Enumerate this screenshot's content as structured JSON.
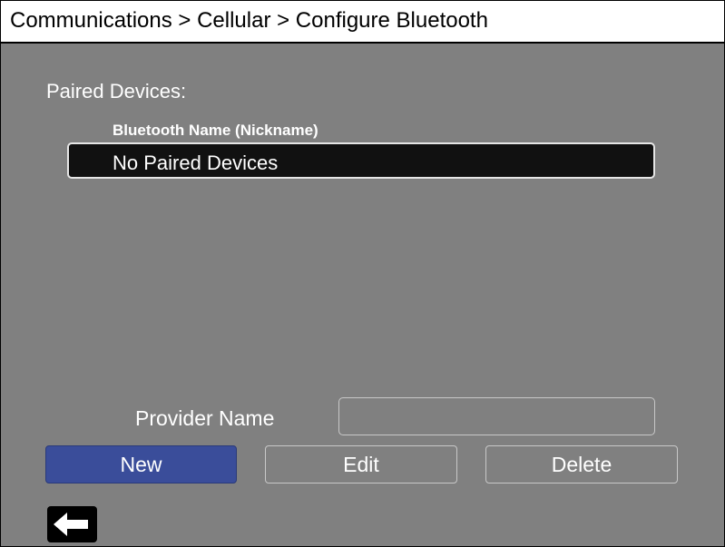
{
  "header": {
    "breadcrumb": "Communications > Cellular > Configure Bluetooth"
  },
  "paired_devices": {
    "section_label": "Paired Devices:",
    "column_header": "Bluetooth Name (Nickname)",
    "rows": [
      {
        "label": "No Paired Devices"
      }
    ]
  },
  "provider": {
    "label": "Provider Name",
    "value": ""
  },
  "actions": {
    "new_label": "New",
    "edit_label": "Edit",
    "delete_label": "Delete"
  },
  "navigation": {
    "back_icon": "arrow-left-icon"
  },
  "colors": {
    "background": "#808080",
    "accent_button": "#3a4d9a",
    "row_selected": "#111111",
    "title_bar": "#ffffff"
  }
}
